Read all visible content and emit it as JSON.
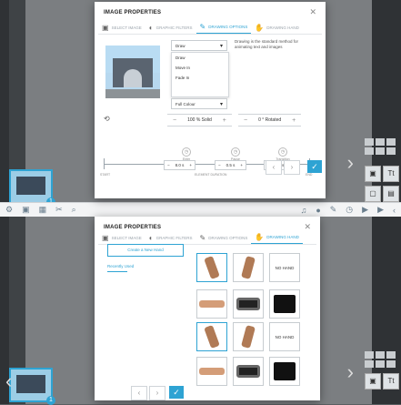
{
  "dialog_top": {
    "title": "IMAGE PROPERTIES",
    "tabs": [
      {
        "label": "SELECT IMAGE",
        "icon": "image-icon"
      },
      {
        "label": "GRAPHIC FILTERS",
        "icon": "filter-icon"
      },
      {
        "label": "DRAWING OPTIONS",
        "icon": "pencil-icon"
      },
      {
        "label": "DRAWING HAND",
        "icon": "hand-icon"
      }
    ],
    "drawing_select": "Draw",
    "drawing_menu": [
      "Draw",
      "Move In",
      "Fade In"
    ],
    "help_text": "Drawing is the standard method for animating text and images",
    "colour_select": "Full Colour",
    "opacity": "100 % Solid",
    "rotation": "0 ° Rotated",
    "timeline": {
      "enter_label": "Enter",
      "pause_label": "Pause",
      "transition_label": "Transition",
      "enter_value": "8.0 s",
      "pause_value": "0.5 s",
      "transition_value": "1.0 s",
      "start_label": "START",
      "end_label": "END",
      "element_label": "ELEMENT DURATION"
    }
  },
  "dialog_bottom": {
    "title": "IMAGE PROPERTIES",
    "tabs": [
      {
        "label": "SELECT IMAGE",
        "icon": "image-icon"
      },
      {
        "label": "GRAPHIC FILTERS",
        "icon": "filter-icon"
      },
      {
        "label": "DRAWING OPTIONS",
        "icon": "pencil-icon"
      },
      {
        "label": "DRAWING HAND",
        "icon": "hand-icon"
      }
    ],
    "create_button": "Create a New Hand",
    "recently_used": "Recently Used",
    "no_hand_label": "NO HAND"
  },
  "colors": {
    "accent": "#2ea3d3",
    "canvas": "#7b7e81",
    "app_bg": "#3f4346"
  }
}
